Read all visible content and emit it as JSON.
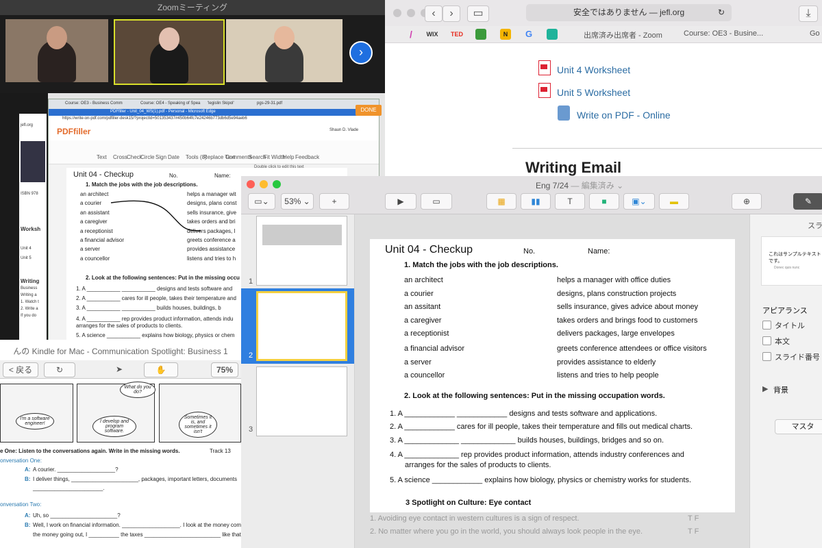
{
  "zoom": {
    "title": "Zoomミーティング"
  },
  "safari": {
    "security": "安全ではありません — jefl.org",
    "tabs": [
      "出席済み出席者 - Zoom",
      "Course: OE3 - Busine...",
      "Go"
    ],
    "fav_labels": [
      "WIX",
      "TED"
    ],
    "links": [
      "Unit 4 Worksheet",
      "Unit 5 Worksheet",
      "Write on PDF - Online"
    ],
    "heading": "Writing Email"
  },
  "edge": {
    "tabs": [
      "Course: OE3 - Business Comm",
      "Course: OE4 - Speaking of Spea",
      "'legislin Skipol'",
      "pgs-29-31.pdf"
    ],
    "url": "https://write-on-pdf.com/pdfiller-desk15/?projectId=501353437#450b64fc7e24246b773db6d5e94aeb6",
    "window_title": "PDFfiller - Unit_04_WS(1).pdf - Personal - Microsoft Edge",
    "brand": "PDFfiller",
    "done": "DONE",
    "tools": [
      "Text",
      "Cross",
      "Check",
      "Circle",
      "Sign",
      "Date",
      "Tools (8)",
      "Replace Text",
      "Comments",
      "Search",
      "Fit Width",
      "Help",
      "Feedback"
    ],
    "hint": "Double click to edit this text",
    "user": "Shaun D. Vlade",
    "doc": {
      "title": "Unit 04 - Checkup",
      "no": "No.",
      "name": "Name:",
      "q1": "1.    Match the jobs with the job descriptions.",
      "jobs": [
        "an architect",
        "a courier",
        "an assistant",
        "a caregiver",
        "a receptionist",
        "a financial advisor",
        "a server",
        "a councellor"
      ],
      "descs": [
        "helps a manager wit",
        "designs, plans const",
        "sells insurance, give",
        "takes orders and bri",
        "delivers packages, l",
        "greets conference a",
        "provides assistance",
        "listens and tries to h"
      ],
      "q2": "2.    Look at the following sentences:  Put in the missing occu",
      "s": [
        "1.  A ___________  ___________  designs and tests software and",
        "2.  A ___________  cares for ill people, takes their temperature and",
        "3.  A ___________  ___________  builds houses, buildings, b",
        "4.  A ___________  rep provides product information, attends indu",
        "     arranges for the sales of products to clients.",
        "5.  A  science  ___________  explains how biology, physics or chem"
      ]
    },
    "side": [
      "jefl.org",
      "ISBN 978",
      "Worksh",
      "Unit 4",
      "Unit 5",
      "Writing",
      "Business",
      "Writing a",
      "1. Watch t",
      "2. Write a",
      "If you do"
    ]
  },
  "kindle": {
    "title": "んの Kindle for Mac - Communication Spotlight: Business 1",
    "back": "< 戻る",
    "zoom": "75%",
    "bubbles": [
      "I'm a software engineer!",
      "What do you do?",
      "I develop and program software.",
      "Sometimes it is, and sometimes it isn't"
    ],
    "instr": "e One: Listen to the conversations again. Write in the missing words.",
    "track": "Track 13",
    "conv1": "onversation One:",
    "a1": "A courier. ___________________?",
    "b1": "I deliver things, ______________________, packages, important letters, documents",
    "b1b": "_______________________.",
    "conv2": "onversation Two:",
    "a2": "Uh, so ______________________?",
    "b2": "Well, I work on financial information. ___________________. I look at the money coming in,",
    "b2b": "the money going out, I __________ the taxes _________________________ like that."
  },
  "keynote": {
    "title": "Eng 7/24",
    "status": "— 編集済み",
    "zoom": "53%",
    "slide_nums": [
      "1",
      "2",
      "3"
    ],
    "slide": {
      "title": "Unit 04 - Checkup",
      "no": "No.",
      "name": "Name:",
      "q1": "1.    Match the jobs with the job descriptions.",
      "jobs": [
        "an architect",
        "a courier",
        "an assitant",
        "a caregiver",
        "a receptionist",
        "a financial advisor",
        "a server",
        "a councellor"
      ],
      "descs": [
        "helps a manager with office duties",
        "designs, plans construction projects",
        "sells insurance, gives advice about money",
        "takes orders and brings food to customers",
        "delivers packages, large envelopes",
        "greets conference attendees or office visitors",
        "provides assistance to elderly",
        "listens and tries to help people"
      ],
      "q2": "2.     Look at the following sentences:  Put in the missing occupation words.",
      "s1": "1.  A ____________  ____________  designs and tests software and applications.",
      "s2": "2.  A ____________   cares for ill people, takes their temperature and fills out medical charts.",
      "s3": "3.  A _____________   _____________   builds houses, buildings, bridges and so on.",
      "s4": "4.  A _____________   rep provides product information, attends industry conferences and",
      "s4b": "arranges for the sales of products to clients.",
      "s5": "5.  A  science  ____________ explains how biology, physics or chemistry works for students.",
      "q3": "3     Spotlight on Culture: Eye contact"
    },
    "notes": [
      "1. Avoiding eye contact in western cultures is a sign of respect.",
      "2. No matter where you go in the world, you should always look people in the eye."
    ],
    "tf": "T     F",
    "inspector": {
      "tab": "スラ",
      "sample": "これはサンプルテキストです。",
      "sample_sub": "Donec quis nunc",
      "appearance": "アピアランス",
      "opts": [
        "タイトル",
        "本文",
        "スライド番号"
      ],
      "bg": "背景",
      "master": "マスタ"
    }
  }
}
